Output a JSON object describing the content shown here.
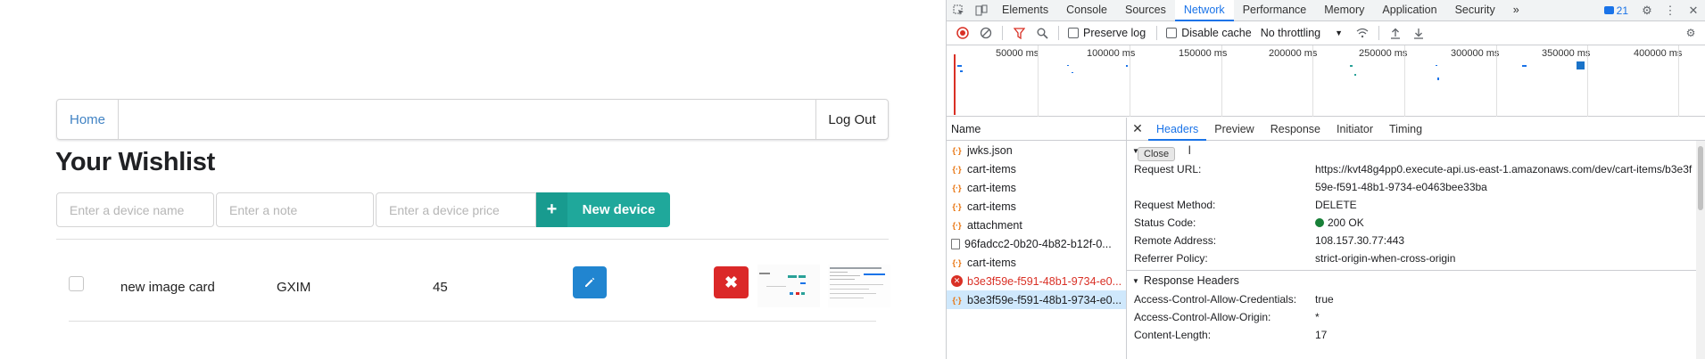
{
  "app": {
    "nav": {
      "home": "Home",
      "logout": "Log Out"
    },
    "title": "Your Wishlist",
    "form": {
      "name_placeholder": "Enter a device name",
      "note_placeholder": "Enter a note",
      "price_placeholder": "Enter a device price",
      "new_button": "New device",
      "plus": "+"
    },
    "items": [
      {
        "name": "new image card",
        "note": "GXIM",
        "price": "45"
      }
    ]
  },
  "devtools": {
    "tabs": [
      "Elements",
      "Console",
      "Sources",
      "Network",
      "Performance",
      "Memory",
      "Application",
      "Security"
    ],
    "active_tab": "Network",
    "more": "»",
    "issues_count": "21",
    "toolbar": {
      "preserve_log": "Preserve log",
      "disable_cache": "Disable cache",
      "throttling": "No throttling"
    },
    "timeline_labels": [
      "50000 ms",
      "100000 ms",
      "150000 ms",
      "200000 ms",
      "250000 ms",
      "300000 ms",
      "350000 ms",
      "400000 ms"
    ],
    "name_header": "Name",
    "requests": [
      {
        "name": "jwks.json",
        "type": "xhr",
        "state": "normal"
      },
      {
        "name": "cart-items",
        "type": "xhr",
        "state": "normal"
      },
      {
        "name": "cart-items",
        "type": "xhr",
        "state": "normal"
      },
      {
        "name": "cart-items",
        "type": "xhr",
        "state": "normal"
      },
      {
        "name": "attachment",
        "type": "xhr",
        "state": "normal"
      },
      {
        "name": "96fadcc2-0b20-4b82-b12f-0...",
        "type": "doc",
        "state": "normal"
      },
      {
        "name": "cart-items",
        "type": "xhr",
        "state": "normal"
      },
      {
        "name": "b3e3f59e-f591-48b1-9734-e0...",
        "type": "err",
        "state": "error"
      },
      {
        "name": "b3e3f59e-f591-48b1-9734-e0...",
        "type": "xhr",
        "state": "selected"
      }
    ],
    "detail_tabs": [
      "Headers",
      "Preview",
      "Response",
      "Initiator",
      "Timing"
    ],
    "active_detail_tab": "Headers",
    "tooltip": "Close",
    "general_partial": "l",
    "general": [
      {
        "key": "Request URL:",
        "value": "https://kvt48g4pp0.execute-api.us-east-1.amazonaws.com/dev/cart-items/b3e3f59e-f591-48b1-9734-e0463bee33ba"
      },
      {
        "key": "Request Method:",
        "value": "DELETE"
      },
      {
        "key": "Status Code:",
        "value": "200 OK"
      },
      {
        "key": "Remote Address:",
        "value": "108.157.30.77:443"
      },
      {
        "key": "Referrer Policy:",
        "value": "strict-origin-when-cross-origin"
      }
    ],
    "response_headers_title": "Response Headers",
    "response_headers": [
      {
        "key": "Access-Control-Allow-Credentials:",
        "value": "true"
      },
      {
        "key": "Access-Control-Allow-Origin:",
        "value": "*"
      },
      {
        "key": "Content-Length:",
        "value": "17"
      }
    ]
  }
}
